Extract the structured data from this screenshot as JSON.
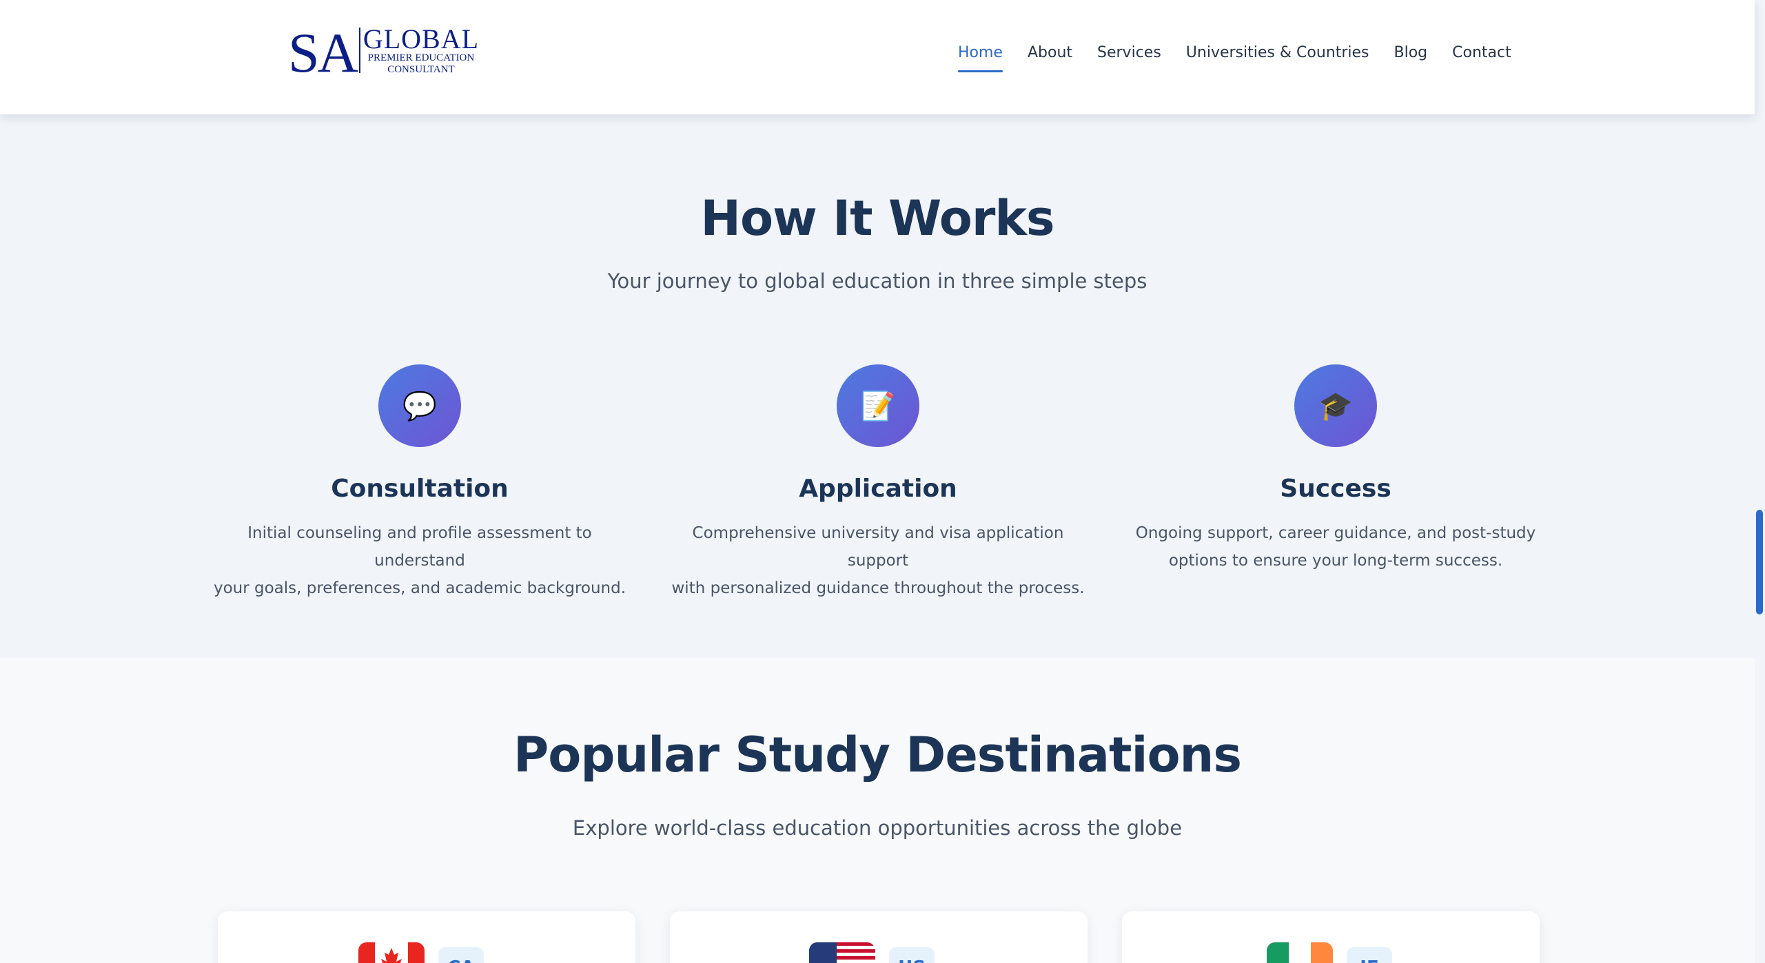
{
  "header": {
    "logo": {
      "main": "SA",
      "global": "GLOBAL",
      "line1": "PREMIER EDUCATION",
      "line2": "CONSULTANT"
    },
    "nav": [
      {
        "label": "Home",
        "active": true
      },
      {
        "label": "About",
        "active": false
      },
      {
        "label": "Services",
        "active": false
      },
      {
        "label": "Universities & Countries",
        "active": false
      },
      {
        "label": "Blog",
        "active": false
      },
      {
        "label": "Contact",
        "active": false
      }
    ]
  },
  "how_it_works": {
    "title": "How It Works",
    "subtitle": "Your journey to global education in three simple steps",
    "steps": [
      {
        "icon": "speech-bubble-icon",
        "glyph": "💬",
        "title": "Consultation",
        "desc_line1": "Initial counseling and profile assessment to understand",
        "desc_line2": "your goals, preferences, and academic background."
      },
      {
        "icon": "document-pencil-icon",
        "glyph": "📝",
        "title": "Application",
        "desc_line1": "Comprehensive university and visa application support",
        "desc_line2": "with personalized guidance throughout the process."
      },
      {
        "icon": "graduation-cap-icon",
        "glyph": "🎓",
        "title": "Success",
        "desc_line1": "Ongoing support, career guidance, and post-study",
        "desc_line2": "options to ensure your long-term success."
      }
    ]
  },
  "destinations": {
    "title": "Popular Study Destinations",
    "subtitle": "Explore world-class education opportunities across the globe",
    "cards": [
      {
        "flag": "canada-flag-icon",
        "code": "CA"
      },
      {
        "flag": "usa-flag-icon",
        "code": "US"
      },
      {
        "flag": "ireland-flag-icon",
        "code": "IE"
      }
    ]
  },
  "colors": {
    "accent": "#2a6bc9",
    "heading": "#1c3557",
    "logo": "#0c1f86",
    "icon_gradient_start": "#4d7be0",
    "icon_gradient_end": "#6e55d3"
  }
}
